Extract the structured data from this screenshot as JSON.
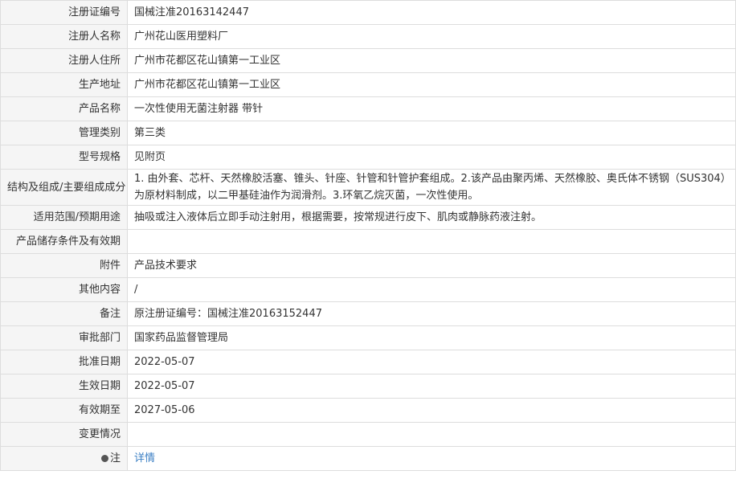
{
  "rows": [
    {
      "label": "注册证编号",
      "value": "国械注准20163142447"
    },
    {
      "label": "注册人名称",
      "value": "广州花山医用塑料厂"
    },
    {
      "label": "注册人住所",
      "value": "广州市花都区花山镇第一工业区"
    },
    {
      "label": "生产地址",
      "value": "广州市花都区花山镇第一工业区"
    },
    {
      "label": "产品名称",
      "value": "一次性使用无菌注射器 带针"
    },
    {
      "label": "管理类别",
      "value": "第三类"
    },
    {
      "label": "型号规格",
      "value": "见附页"
    },
    {
      "label": "结构及组成/主要组成成分",
      "value": "1. 由外套、芯杆、天然橡胶活塞、锥头、针座、针管和针管护套组成。2.该产品由聚丙烯、天然橡胶、奥氏体不锈钢（SUS304）为原材料制成，以二甲基硅油作为润滑剂。3.环氧乙烷灭菌，一次性使用。"
    },
    {
      "label": "适用范围/预期用途",
      "value": "抽吸或注入液体后立即手动注射用，根据需要，按常规进行皮下、肌肉或静脉药液注射。"
    },
    {
      "label": "产品储存条件及有效期",
      "value": ""
    },
    {
      "label": "附件",
      "value": "产品技术要求"
    },
    {
      "label": "其他内容",
      "value": "/"
    },
    {
      "label": "备注",
      "value": "原注册证编号：国械注准20163152447"
    },
    {
      "label": "审批部门",
      "value": "国家药品监督管理局"
    },
    {
      "label": "批准日期",
      "value": "2022-05-07"
    },
    {
      "label": "生效日期",
      "value": "2022-05-07"
    },
    {
      "label": "有效期至",
      "value": "2027-05-06"
    },
    {
      "label": "变更情况",
      "value": ""
    }
  ],
  "note": {
    "label": "注",
    "link_text": "详情",
    "icon": "pin-icon"
  }
}
